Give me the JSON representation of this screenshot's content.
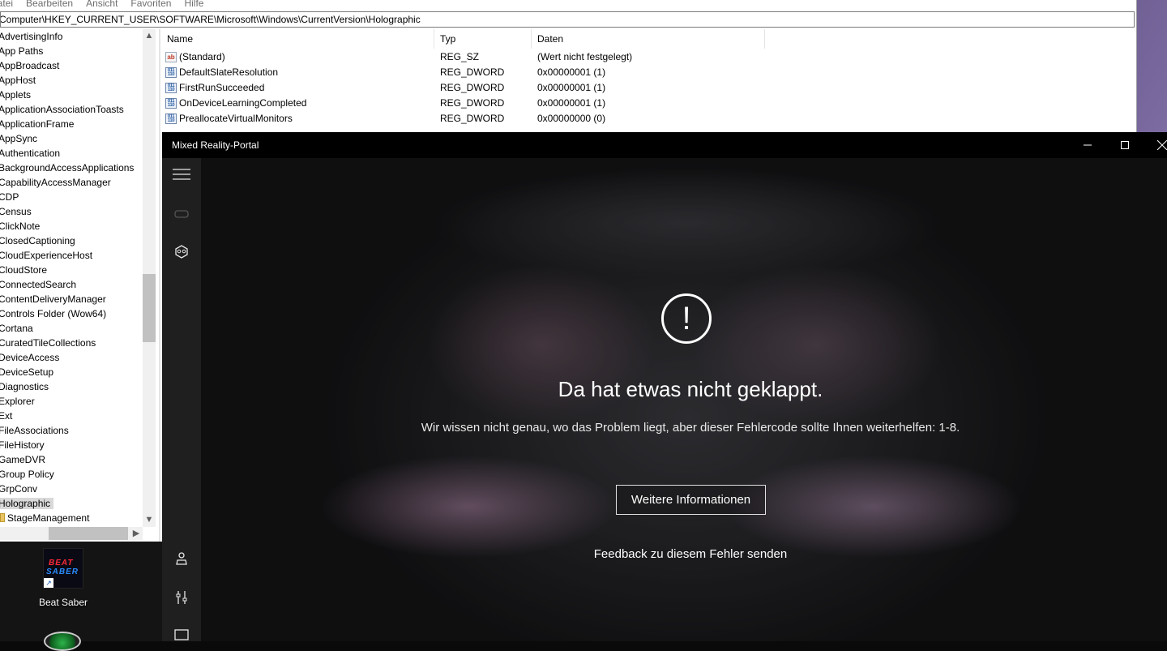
{
  "regedit": {
    "menu": [
      "Datei",
      "Bearbeiten",
      "Ansicht",
      "Favoriten",
      "Hilfe"
    ],
    "address": "Computer\\HKEY_CURRENT_USER\\SOFTWARE\\Microsoft\\Windows\\CurrentVersion\\Holographic",
    "tree": [
      "AdvertisingInfo",
      "App Paths",
      "AppBroadcast",
      "AppHost",
      "Applets",
      "ApplicationAssociationToasts",
      "ApplicationFrame",
      "AppSync",
      "Authentication",
      "BackgroundAccessApplications",
      "CapabilityAccessManager",
      "CDP",
      "Census",
      "ClickNote",
      "ClosedCaptioning",
      "CloudExperienceHost",
      "CloudStore",
      "ConnectedSearch",
      "ContentDeliveryManager",
      "Controls Folder (Wow64)",
      "Cortana",
      "CuratedTileCollections",
      "DeviceAccess",
      "DeviceSetup",
      "Diagnostics",
      "Explorer",
      "Ext",
      "FileAssociations",
      "FileHistory",
      "GameDVR",
      "Group Policy",
      "GrpConv",
      "Holographic"
    ],
    "tree_child": "StageManagement",
    "columns": {
      "name": "Name",
      "type": "Typ",
      "data": "Daten"
    },
    "values": [
      {
        "icon": "string",
        "name": "(Standard)",
        "type": "REG_SZ",
        "data": "(Wert nicht festgelegt)"
      },
      {
        "icon": "dword",
        "name": "DefaultSlateResolution",
        "type": "REG_DWORD",
        "data": "0x00000001 (1)"
      },
      {
        "icon": "dword",
        "name": "FirstRunSucceeded",
        "type": "REG_DWORD",
        "data": "0x00000001 (1)"
      },
      {
        "icon": "dword",
        "name": "OnDeviceLearningCompleted",
        "type": "REG_DWORD",
        "data": "0x00000001 (1)"
      },
      {
        "icon": "dword",
        "name": "PreallocateVirtualMonitors",
        "type": "REG_DWORD",
        "data": "0x00000000 (0)"
      }
    ]
  },
  "portal": {
    "title": "Mixed Reality-Portal",
    "error": {
      "title": "Da hat etwas nicht geklappt.",
      "description": "Wir wissen nicht genau, wo das Problem liegt, aber dieser Fehlercode sollte Ihnen weiterhelfen: 1-8.",
      "more_info_label": "Weitere Informationen",
      "feedback_label": "Feedback zu diesem Fehler senden"
    }
  },
  "desktop": {
    "icon_label": "Beat Saber",
    "logo_line1": "BEAT",
    "logo_line2": "SABER"
  }
}
